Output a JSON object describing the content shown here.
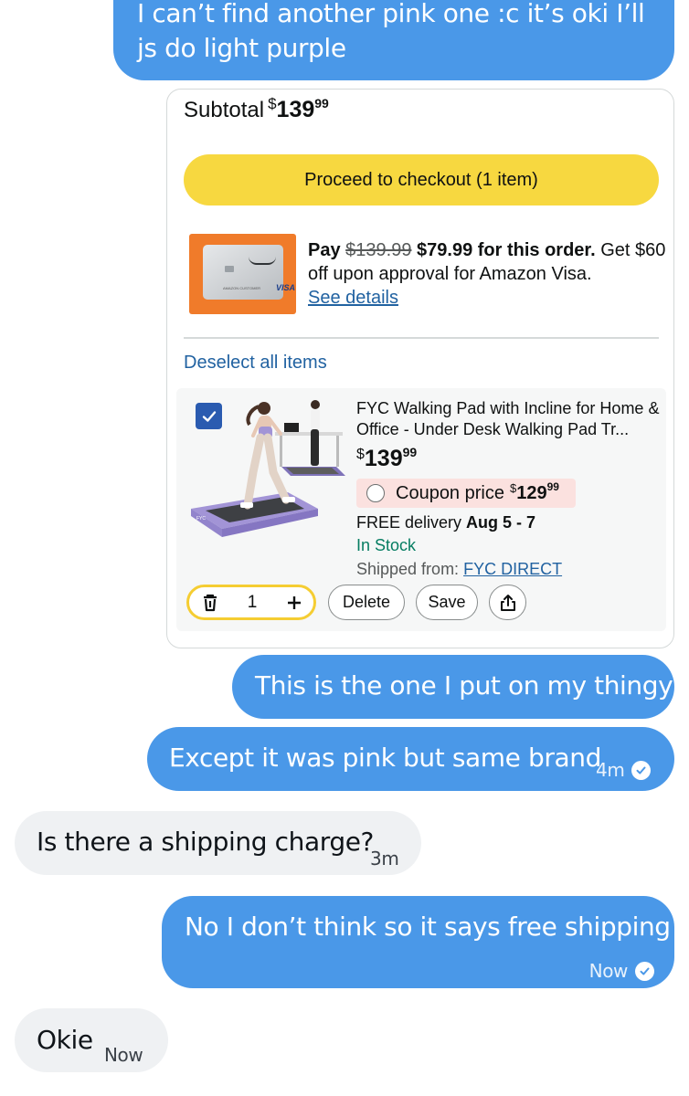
{
  "messages": [
    {
      "id": "m1",
      "direction": "out",
      "text": "I can’t find another pink one :c it’s oki I’ll js do light purple"
    },
    {
      "id": "m2",
      "direction": "out",
      "text": "This is the one I put on my thingy"
    },
    {
      "id": "m3",
      "direction": "out",
      "text": "Except it was pink but same brand",
      "time": "4m",
      "status_icon": "read-check-icon"
    },
    {
      "id": "m4",
      "direction": "in",
      "text": "Is there a shipping charge?",
      "time": "3m"
    },
    {
      "id": "m5",
      "direction": "out",
      "text": "No I don’t think so it says free shipping",
      "time": "Now",
      "status_icon": "read-check-icon"
    },
    {
      "id": "m6",
      "direction": "in",
      "text": "Okie",
      "time": "Now"
    }
  ],
  "cart": {
    "subtotal_label": "Subtotal",
    "subtotal_currency": "$",
    "subtotal_whole": "139",
    "subtotal_cents": "99",
    "checkout_label": "Proceed to checkout (1 item)",
    "promo": {
      "pay": "Pay",
      "old_price": "$139.99",
      "new_price_text": "$79.99 for this order.",
      "rest": "Get $60 off upon approval for Amazon Visa.",
      "link": "See details",
      "card_name": "AMAZON CUSTOMER",
      "card_brand": "VISA"
    },
    "deselect_label": "Deselect all items",
    "item": {
      "selected": true,
      "title": "FYC Walking Pad with Incline for Home & Office - Under Desk Walking Pad Tr...",
      "price_currency": "$",
      "price_whole": "139",
      "price_cents": "99",
      "coupon_label": "Coupon price",
      "coupon_currency": "$",
      "coupon_whole": "129",
      "coupon_cents": "99",
      "delivery_prefix": "FREE delivery",
      "delivery_date": "Aug 5 - 7",
      "stock": "In Stock",
      "shipped_label": "Shipped from:",
      "shipped_seller": "FYC DIRECT",
      "quantity": "1",
      "delete_label": "Delete",
      "save_label": "Save"
    }
  },
  "colors": {
    "outgoing_bubble": "#4a98e8",
    "incoming_bubble": "#eff1f3",
    "checkout_button": "#f7d840",
    "link": "#2162a1",
    "in_stock": "#067d62",
    "coupon_bg": "#fbe1df",
    "checkbox": "#2a5bb0",
    "product_purple": "#a294d6"
  }
}
